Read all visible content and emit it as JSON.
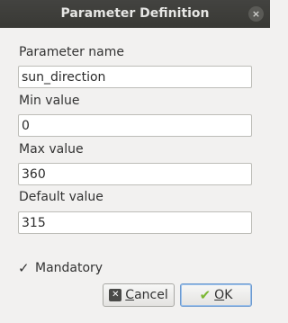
{
  "window": {
    "title": "Parameter Definition",
    "close_glyph": "×"
  },
  "fields": {
    "name": {
      "label": "Parameter name",
      "value": "sun_direction"
    },
    "min": {
      "label": "Min value",
      "value": "0"
    },
    "max": {
      "label": "Max value",
      "value": "360"
    },
    "default": {
      "label": "Default value",
      "value": "315"
    }
  },
  "mandatory": {
    "label": "Mandatory",
    "checked": true,
    "check_glyph": "✓"
  },
  "buttons": {
    "cancel": {
      "underline": "C",
      "rest": "ancel",
      "icon": "cancel-icon",
      "icon_glyph": "✕"
    },
    "ok": {
      "underline": "O",
      "rest": "K",
      "icon": "checkmark-icon",
      "icon_glyph": "✔"
    }
  }
}
